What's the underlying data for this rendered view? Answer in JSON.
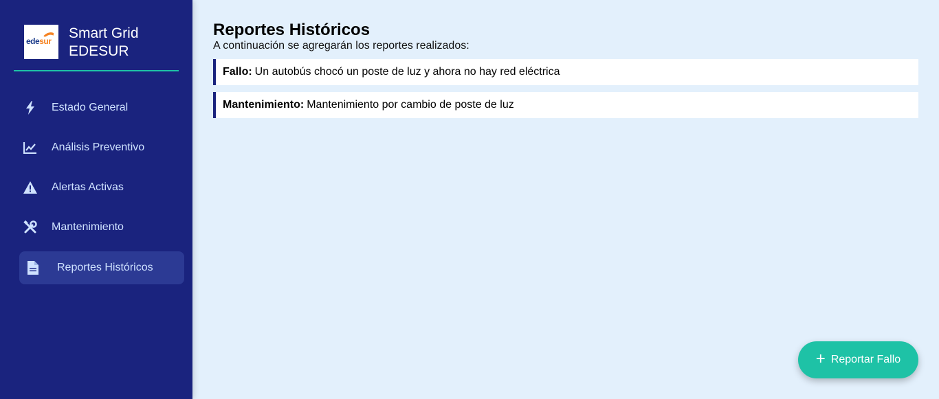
{
  "sidebar": {
    "logo": {
      "text_left": "ede",
      "text_right": "sur",
      "brand_color": "#1a3a8a",
      "accent_color": "#f58220"
    },
    "title_line1": "Smart Grid",
    "title_line2": "EDESUR",
    "items": [
      {
        "label": "Estado General",
        "icon": "bolt-icon",
        "active": false
      },
      {
        "label": "Análisis Preventivo",
        "icon": "line-chart-icon",
        "active": false
      },
      {
        "label": "Alertas Activas",
        "icon": "warning-icon",
        "active": false
      },
      {
        "label": "Mantenimiento",
        "icon": "tools-icon",
        "active": false
      },
      {
        "label": "Reportes Históricos",
        "icon": "document-icon",
        "active": true
      }
    ]
  },
  "main": {
    "title": "Reportes Históricos",
    "subtitle": "A continuación se agregarán los reportes realizados:",
    "reports": [
      {
        "type": "Fallo:",
        "description": "Un autobús chocó un poste de luz y ahora no hay red eléctrica"
      },
      {
        "type": "Mantenimiento:",
        "description": "Mantenimiento por cambio de poste de luz"
      }
    ]
  },
  "fab": {
    "icon": "plus-icon",
    "label": "Reportar Fallo"
  },
  "colors": {
    "sidebar_bg": "#1a237e",
    "accent": "#1ec2a6",
    "page_bg": "#e3f0fc",
    "nav_text": "#cfe2ff"
  }
}
